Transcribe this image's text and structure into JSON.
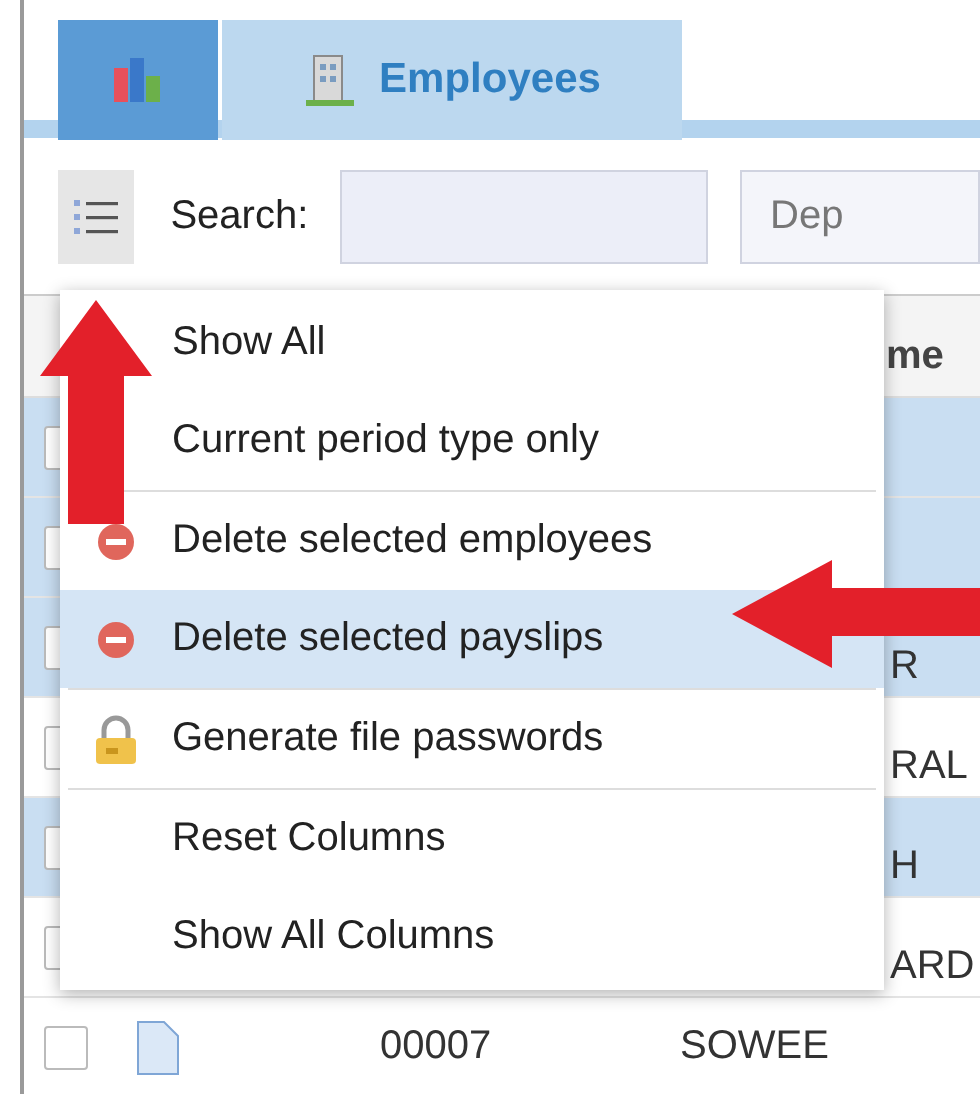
{
  "tabs": [
    {
      "kind": "icon",
      "selected": false
    },
    {
      "kind": "text",
      "label": "Employees",
      "selected": true
    }
  ],
  "toolbar": {
    "search_label": "Search:",
    "department_placeholder": "Dep"
  },
  "table": {
    "header": "me",
    "rows": [
      {
        "kind": "partial",
        "selected": true
      },
      {
        "kind": "partial",
        "selected": true
      },
      {
        "kind": "partial",
        "selected": true,
        "name": "R"
      },
      {
        "kind": "partial",
        "selected": false,
        "name": "RAL"
      },
      {
        "kind": "partial",
        "selected": true,
        "name": "H"
      },
      {
        "kind": "partial",
        "selected": false,
        "name": "ARD"
      },
      {
        "kind": "full",
        "selected": false,
        "code": "00007",
        "name": "SOWEE"
      }
    ]
  },
  "menu": {
    "items": [
      {
        "kind": "plain",
        "label": "Show All",
        "selected": false
      },
      {
        "kind": "plain",
        "label": "Current period type only",
        "selected": false
      },
      {
        "kind": "separator"
      },
      {
        "kind": "delete",
        "label": "Delete selected employees",
        "selected": false
      },
      {
        "kind": "delete",
        "label": "Delete selected payslips",
        "selected": true
      },
      {
        "kind": "separator"
      },
      {
        "kind": "lock",
        "label": "Generate file passwords",
        "selected": false
      },
      {
        "kind": "separator"
      },
      {
        "kind": "plain",
        "label": "Reset Columns",
        "selected": false
      },
      {
        "kind": "plain",
        "label": "Show All Columns",
        "selected": false
      }
    ]
  }
}
